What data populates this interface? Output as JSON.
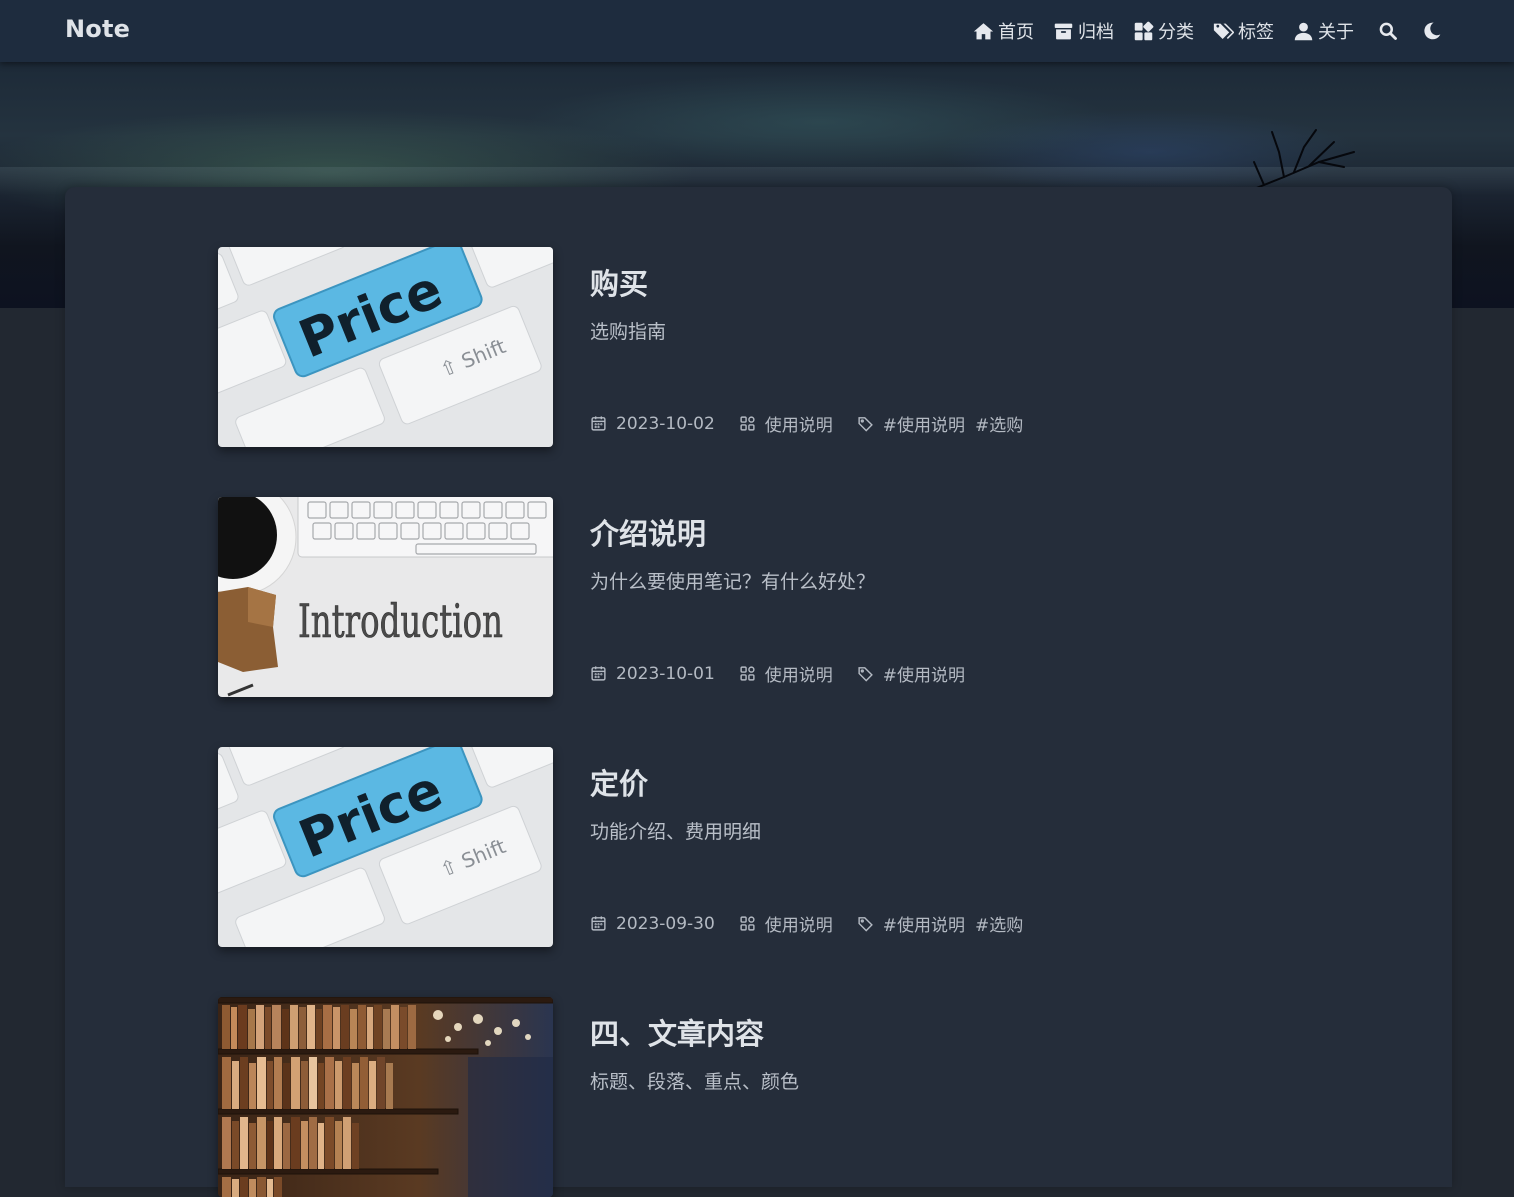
{
  "brand": "Note",
  "nav": {
    "items": [
      {
        "label": "首页",
        "icon": "home-icon"
      },
      {
        "label": "归档",
        "icon": "archive-icon"
      },
      {
        "label": "分类",
        "icon": "category-icon"
      },
      {
        "label": "标签",
        "icon": "tags-icon"
      },
      {
        "label": "关于",
        "icon": "user-icon"
      }
    ],
    "search_icon": "search-icon",
    "theme_icon": "moon-icon"
  },
  "posts": [
    {
      "title": "购买",
      "desc": "选购指南",
      "date": "2023-10-02",
      "category": "使用说明",
      "tags": [
        "#使用说明",
        "#选购"
      ],
      "thumb": "price-keyboard",
      "thumb_text": "Price"
    },
    {
      "title": "介绍说明",
      "desc": "为什么要使用笔记？有什么好处？",
      "date": "2023-10-01",
      "category": "使用说明",
      "tags": [
        "#使用说明"
      ],
      "thumb": "introduction",
      "thumb_text": "Introduction"
    },
    {
      "title": "定价",
      "desc": "功能介绍、费用明细",
      "date": "2023-09-30",
      "category": "使用说明",
      "tags": [
        "#使用说明",
        "#选购"
      ],
      "thumb": "price-keyboard",
      "thumb_text": "Price"
    },
    {
      "title": "四、文章内容",
      "desc": "标题、段落、重点、颜色",
      "date": "",
      "category": "",
      "tags": [],
      "thumb": "bookshelf",
      "thumb_text": ""
    }
  ],
  "colors": {
    "navbar": "#1e2c3e",
    "page_bg": "#222831",
    "card_bg": "#252d3a",
    "accent_blue": "#5bb8e3"
  }
}
